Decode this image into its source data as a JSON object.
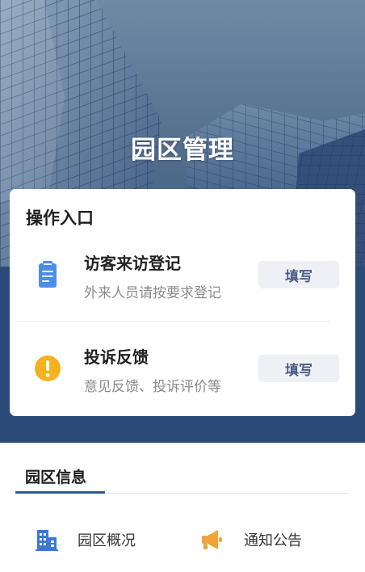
{
  "header": {
    "title": "园区管理"
  },
  "entry_card": {
    "title": "操作入口",
    "items": [
      {
        "name": "访客来访登记",
        "desc": "外来人员请按要求登记",
        "button": "填写",
        "icon": "clipboard-icon"
      },
      {
        "name": "投诉反馈",
        "desc": "意见反馈、投诉评价等",
        "button": "填写",
        "icon": "exclamation-icon"
      }
    ]
  },
  "park_info": {
    "tab": "园区信息",
    "links": [
      {
        "label": "园区概况",
        "icon": "building-icon"
      },
      {
        "label": "通知公告",
        "icon": "megaphone-icon"
      }
    ]
  },
  "colors": {
    "accent": "#2f5a8e",
    "clipboard_icon": "#4a8ee8",
    "alert_icon": "#f5b21f",
    "megaphone_icon": "#f0a33a",
    "button_text": "#4a5d85",
    "button_bg": "#eef0f5"
  }
}
